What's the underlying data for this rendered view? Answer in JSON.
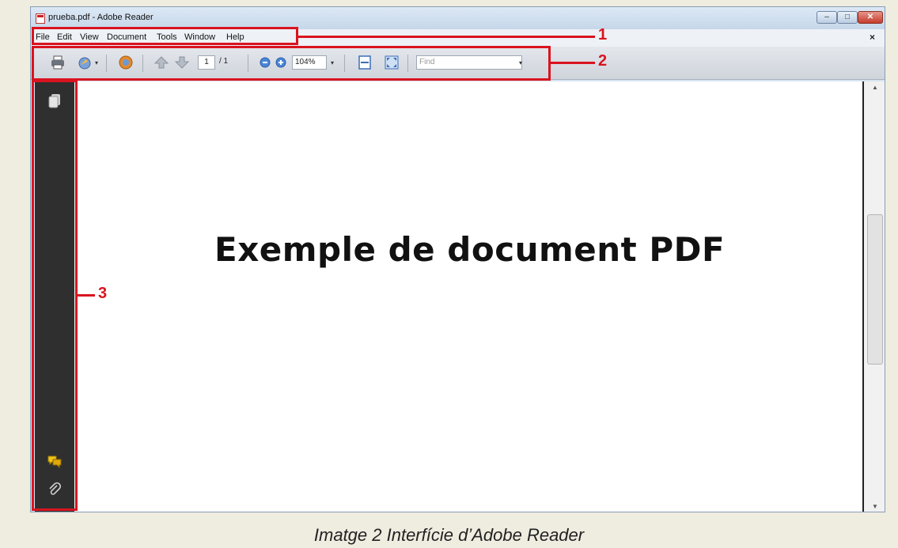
{
  "window": {
    "title": "prueba.pdf - Adobe Reader",
    "minimize": "–",
    "maximize": "□",
    "close": "✕"
  },
  "menu": {
    "items": [
      "File",
      "Edit",
      "View",
      "Document",
      "Tools",
      "Window",
      "Help"
    ],
    "doc_close": "×"
  },
  "toolbar": {
    "icons": [
      "print-icon",
      "share-icon",
      "collaborate-icon",
      "previous-page-icon",
      "next-page-icon",
      "zoom-out-icon",
      "zoom-in-icon",
      "fit-page-icon",
      "full-screen-icon"
    ],
    "page_current": "1",
    "page_total": "/ 1",
    "zoom": "104%",
    "find_placeholder": "Find"
  },
  "navigation_panel": {
    "icons": [
      "pages-icon",
      "comments-icon",
      "attachments-icon"
    ]
  },
  "document": {
    "heading": "Exemple de document PDF"
  },
  "annotations": {
    "labels": [
      "1",
      "2",
      "3"
    ],
    "color": "#d9141f"
  },
  "caption": "Imatge 2 Interfície d’Adobe Reader"
}
